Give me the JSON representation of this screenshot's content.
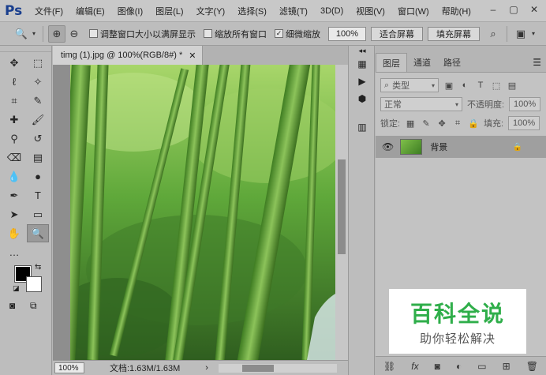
{
  "app": {
    "logo": "Ps"
  },
  "menu": [
    "文件(F)",
    "编辑(E)",
    "图像(I)",
    "图层(L)",
    "文字(Y)",
    "选择(S)",
    "滤镜(T)",
    "3D(D)",
    "视图(V)",
    "窗口(W)",
    "帮助(H)"
  ],
  "window_buttons": [
    "–",
    "▢",
    "✕"
  ],
  "options_bar": {
    "check_resize": "调整窗口大小以满屏显示",
    "check_zoom_all": "缩放所有窗口",
    "check_scrubby": "细微缩放",
    "zoom_value": "100%",
    "fit_screen": "适合屏幕",
    "fill_screen": "填充屏幕"
  },
  "document": {
    "tab_title": "timg (1).jpg @ 100%(RGB/8#) *",
    "status_zoom": "100%",
    "status_doc": "文档:1.63M/1.63M"
  },
  "layers_panel": {
    "tabs": [
      "图层",
      "通道",
      "路径"
    ],
    "filter_kind": "类型",
    "blend_mode": "正常",
    "opacity_label": "不透明度:",
    "opacity_value": "100%",
    "lock_label": "锁定:",
    "fill_label": "填充:",
    "fill_value": "100%",
    "layer_name": "背景"
  },
  "watermark": {
    "main": "百科全说",
    "sub": "助你轻松解决"
  },
  "colors": {
    "foreground": "#000000",
    "background": "#ffffff",
    "watermark_green": "#2fae4a"
  }
}
